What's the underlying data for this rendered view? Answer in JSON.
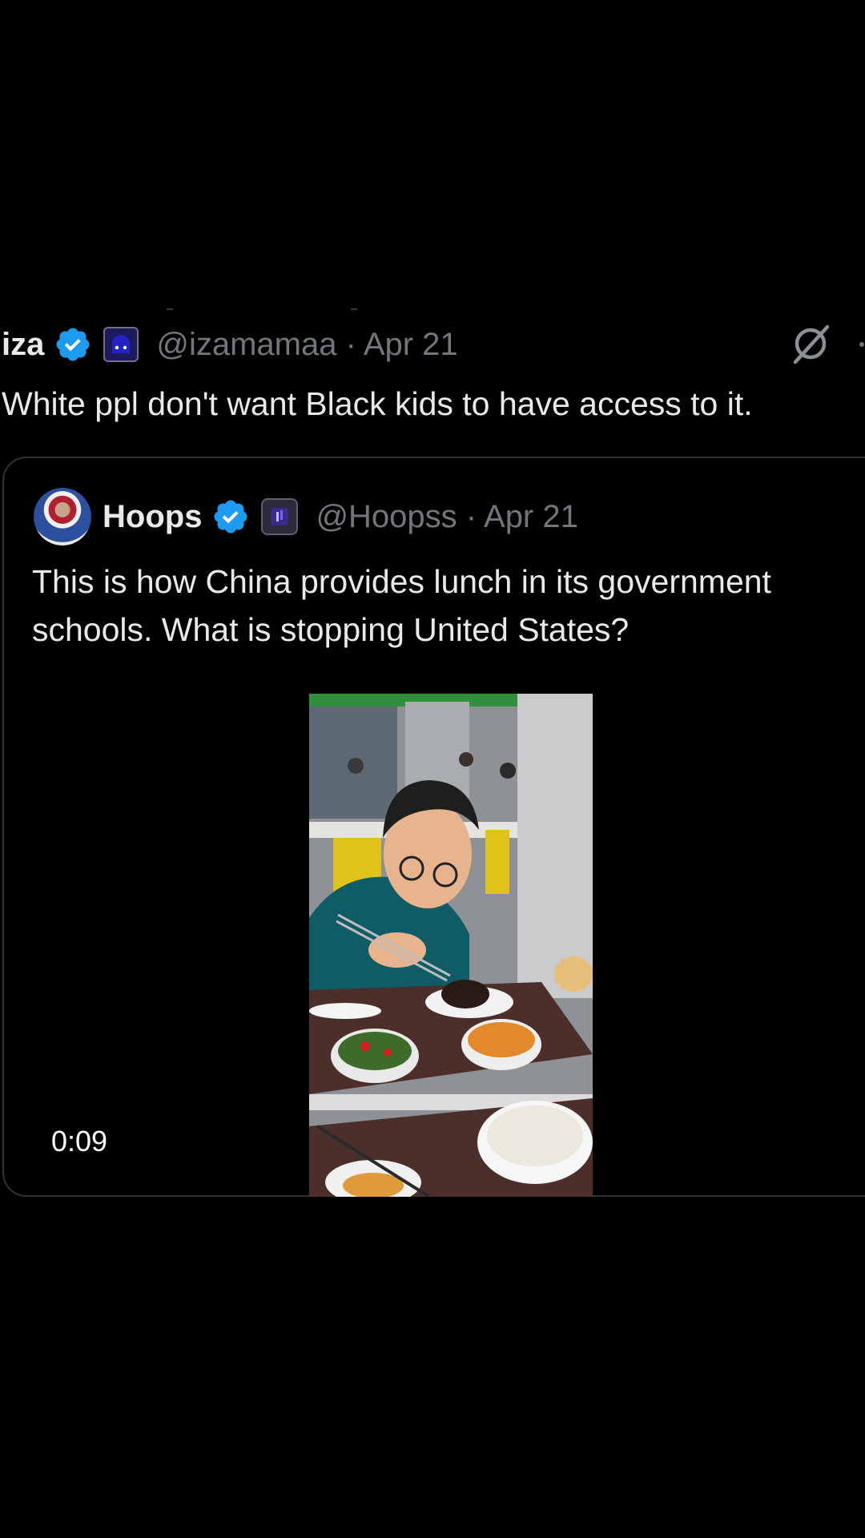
{
  "tweet": {
    "display_name": "iza",
    "handle_date": "@izamamaa · Apr 21",
    "text": "White ppl don't want Black kids to have access to it."
  },
  "quoted_tweet": {
    "display_name": "Hoops",
    "handle_date": "@Hoopss · Apr 21",
    "text_line1": "This is how China provides lunch in its government",
    "text_line2": "schools. What is stopping United States?",
    "video_duration": "0:09"
  },
  "icons": {
    "verified": "verified-badge-icon",
    "grok": "grok-icon",
    "more": "more-icon"
  },
  "colors": {
    "background": "#000000",
    "text": "#e7e9ea",
    "secondary_text": "#71767b",
    "verified_blue": "#1d9bf0",
    "card_border": "#2f3336"
  }
}
